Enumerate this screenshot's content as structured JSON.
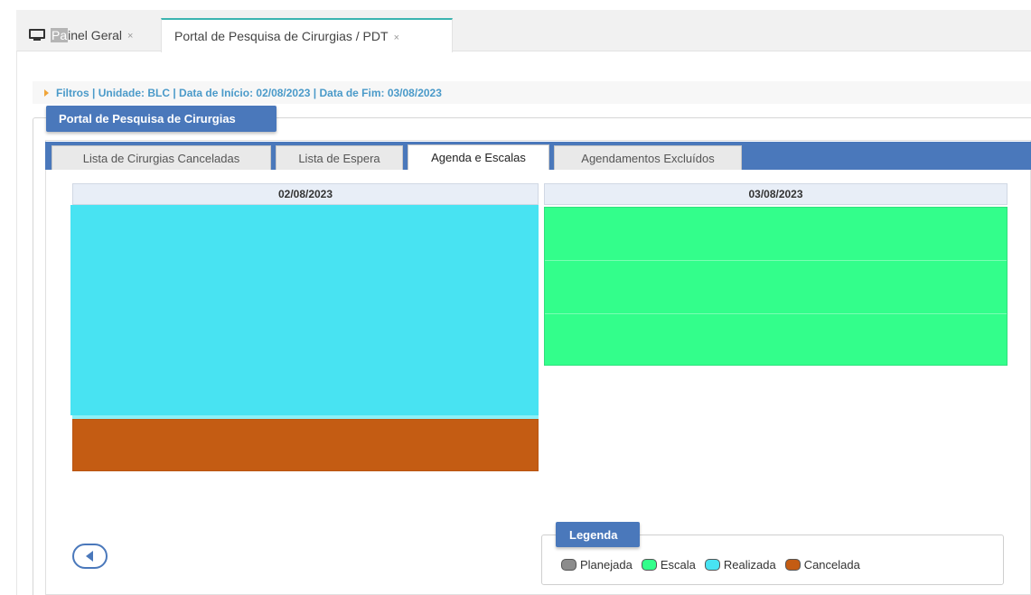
{
  "tabs": [
    {
      "label_highlight": "Pa",
      "label_rest": "inel Geral",
      "close": "×",
      "icon": "monitor-icon"
    },
    {
      "label": "Portal de Pesquisa de Cirurgias / PDT",
      "close": "×"
    }
  ],
  "filters": {
    "text": "Filtros | Unidade: BLC | Data de Início: 02/08/2023 | Data de Fim: 03/08/2023"
  },
  "panel": {
    "title": "Portal de Pesquisa de Cirurgias"
  },
  "subtabs": [
    {
      "label": "Lista de Cirurgias Canceladas"
    },
    {
      "label": "Lista de Espera"
    },
    {
      "label": "Agenda e Escalas",
      "active": true
    },
    {
      "label": "Agendamentos Excluídos"
    }
  ],
  "calendar": {
    "days": [
      {
        "date": "02/08/2023"
      },
      {
        "date": "03/08/2023"
      }
    ]
  },
  "legend": {
    "title": "Legenda",
    "items": [
      {
        "label": "Planejada",
        "color": "#8c8c8c"
      },
      {
        "label": "Escala",
        "color": "#33fe8b"
      },
      {
        "label": "Realizada",
        "color": "#48e3f2"
      },
      {
        "label": "Cancelada",
        "color": "#c45c13"
      }
    ]
  },
  "colors": {
    "accent": "#4a78bb",
    "tab_active_border": "#3bb4b0",
    "filter_text": "#4a9ac9"
  }
}
